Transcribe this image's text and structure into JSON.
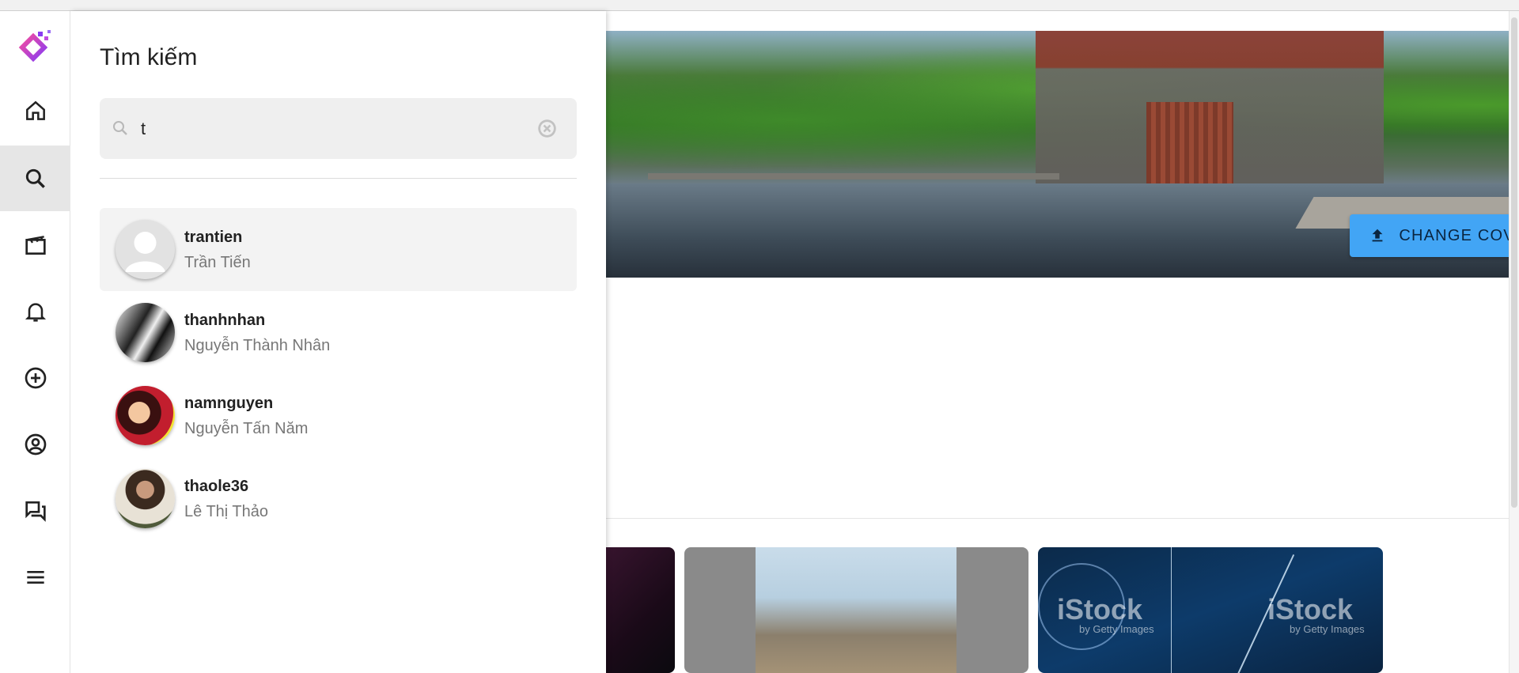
{
  "nav": {
    "logo": "app-logo",
    "items": [
      {
        "icon": "home-icon",
        "active": false
      },
      {
        "icon": "search-icon",
        "active": true
      },
      {
        "icon": "reels-icon",
        "active": false
      },
      {
        "icon": "bell-icon",
        "active": false
      },
      {
        "icon": "add-circle-icon",
        "active": false
      },
      {
        "icon": "profile-icon",
        "active": false
      },
      {
        "icon": "messages-icon",
        "active": false
      },
      {
        "icon": "menu-icon",
        "active": false
      }
    ]
  },
  "search": {
    "title": "Tìm kiếm",
    "query": "t",
    "results": [
      {
        "username": "trantien",
        "fullname": "Trần Tiến"
      },
      {
        "username": "thanhnhan",
        "fullname": "Nguyễn Thành Nhân"
      },
      {
        "username": "namnguyen",
        "fullname": "Nguyễn Tấn Năm"
      },
      {
        "username": "thaole36",
        "fullname": "Lê Thị Thảo"
      }
    ]
  },
  "profile": {
    "change_cover_label": "CHANGE COVER",
    "accent_color": "#42a5f5"
  },
  "thumbnails": {
    "watermark": "iStock",
    "watermark_sub": "by Getty Images"
  }
}
